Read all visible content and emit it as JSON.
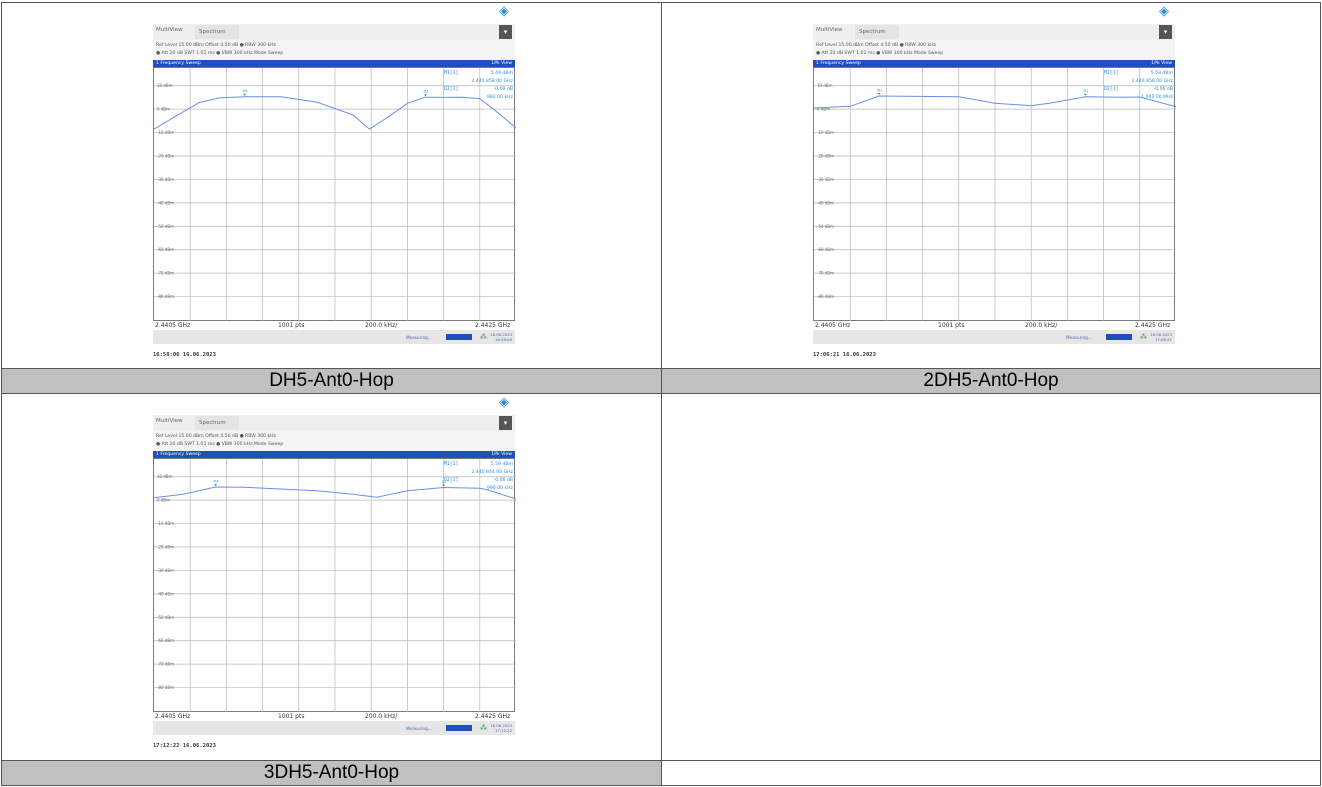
{
  "panels": [
    {
      "caption": "DH5-Ant0-Hop",
      "tabs": [
        "MultiView",
        "Spectrum"
      ],
      "params_line1": "Ref Level 15.00 dBm  Offset 4.50 dB ● RBW 300 kHz",
      "params_line2": "● Att        20 dB  SWT   1.01 ms ● VBW 300 kHz  Mode Sweep",
      "sweep_label": "1 Frequency Sweep",
      "view_label": "1Pk View",
      "marker1_label": "M1[1]",
      "marker1_value": "5.49 dBm",
      "marker1_freq": "2.440 858 00 GHz",
      "delta_label": "D2[1]",
      "delta_value": "-0.09 dB",
      "delta_freq": "982.00 kHz",
      "y_ticks": [
        "10 dBm",
        "0 dBm",
        "-10 dBm",
        "-20 dBm",
        "-30 dBm",
        "-40 dBm",
        "-50 dBm",
        "-60 dBm",
        "-70 dBm",
        "-80 dBm"
      ],
      "x_start": "2.4405 GHz",
      "x_points": "1001 pts",
      "x_span": "200.0 kHz/",
      "x_stop": "2.4425 GHz",
      "status": "Measuring...",
      "status_date": "16.06.2023",
      "status_time": "16:58:06",
      "timestamp": "16:58:06  16.06.2023"
    },
    {
      "caption": "2DH5-Ant0-Hop",
      "tabs": [
        "MultiView",
        "Spectrum"
      ],
      "params_line1": "Ref Level 15.00 dBm  Offset 4.50 dB ● RBW 300 kHz",
      "params_line2": "● Att        20 dB  SWT   1.01 ms ● VBW 300 kHz  Mode Sweep",
      "sweep_label": "1 Frequency Sweep",
      "view_label": "1Pk View",
      "marker1_label": "M1[1]",
      "marker1_value": "5.58 dBm",
      "marker1_freq": "2.440 858 00 GHz",
      "delta_label": "D2[1]",
      "delta_value": "-0.06 dB",
      "delta_freq": "1.000 00 MHz",
      "y_ticks": [
        "10 dBm",
        "0 dBm",
        "-10 dBm",
        "-20 dBm",
        "-30 dBm",
        "-40 dBm",
        "-50 dBm",
        "-60 dBm",
        "-70 dBm",
        "-80 dBm"
      ],
      "x_start": "2.4405 GHz",
      "x_points": "1001 pts",
      "x_span": "200.0 kHz/",
      "x_stop": "2.4425 GHz",
      "status": "Measuring...",
      "status_date": "16.06.2023",
      "status_time": "17:06:21",
      "timestamp": "17:06:21  16.06.2023"
    },
    {
      "caption": "3DH5-Ant0-Hop",
      "tabs": [
        "MultiView",
        "Spectrum"
      ],
      "params_line1": "Ref Level 15.00 dBm  Offset 4.50 dB ● RBW 300 kHz",
      "params_line2": "● Att        20 dB  SWT   1.01 ms ● VBW 300 kHz  Mode Sweep",
      "sweep_label": "1 Frequency Sweep",
      "view_label": "1Pk View",
      "marker1_label": "M1[1]",
      "marker1_value": "5.59 dBm",
      "marker1_freq": "2.440 844 00 GHz",
      "delta_label": "D2[1]",
      "delta_value": "-0.06 dB",
      "delta_freq": "990.00 kHz",
      "y_ticks": [
        "10 dBm",
        "0 dBm",
        "-10 dBm",
        "-20 dBm",
        "-30 dBm",
        "-40 dBm",
        "-50 dBm",
        "-60 dBm",
        "-70 dBm",
        "-80 dBm"
      ],
      "x_start": "2.4405 GHz",
      "x_points": "1001 pts",
      "x_span": "200.0 kHz/",
      "x_stop": "2.4425 GHz",
      "status": "Measuring...",
      "status_date": "16.06.2023",
      "status_time": "17:12:22",
      "timestamp": "17:12:22  16.06.2023"
    }
  ],
  "chart_data": [
    {
      "type": "line",
      "xlabel": "",
      "ylabel": "",
      "xlim": [
        2.4405,
        2.4425
      ],
      "ylim": [
        -90,
        15
      ],
      "series": [
        {
          "x": [
            2.4405,
            2.44062,
            2.44075,
            2.44086,
            2.441,
            2.4412,
            2.4414,
            2.4416,
            2.44169,
            2.4418,
            2.4419,
            2.442,
            2.4421,
            2.4422,
            2.4423,
            2.4424,
            2.4425
          ],
          "values": [
            -8.5,
            -3,
            2.8,
            4.8,
            5.3,
            5.3,
            3,
            -2.5,
            -8.5,
            -3,
            2.5,
            5.1,
            5.0,
            5.1,
            4.5,
            -1.5,
            -8
          ]
        }
      ]
    },
    {
      "type": "line",
      "xlabel": "",
      "ylabel": "",
      "xlim": [
        2.4405,
        2.4425
      ],
      "ylim": [
        -90,
        15
      ],
      "series": [
        {
          "x": [
            2.4405,
            2.4407,
            2.44086,
            2.441,
            2.4413,
            2.4415,
            2.4417,
            2.4418,
            2.442,
            2.4422,
            2.4423,
            2.44238,
            2.4425
          ],
          "values": [
            0.5,
            1.2,
            5.6,
            5.5,
            5.3,
            2.5,
            1.5,
            2.5,
            5.3,
            5.1,
            5.2,
            3.5,
            1.0
          ]
        }
      ]
    },
    {
      "type": "line",
      "xlabel": "",
      "ylabel": "",
      "xlim": [
        2.4405,
        2.4425
      ],
      "ylim": [
        -90,
        15
      ],
      "series": [
        {
          "x": [
            2.4405,
            2.44066,
            2.44084,
            2.441,
            2.4414,
            2.4416,
            2.44173,
            2.4419,
            2.4421,
            2.4423,
            2.44234,
            2.4425
          ],
          "values": [
            1.0,
            2.5,
            5.6,
            5.5,
            4.0,
            2.5,
            1.2,
            4.0,
            5.4,
            5.1,
            4.5,
            0.5
          ]
        }
      ]
    }
  ],
  "colors": {
    "caption_bg": "#c0c0c0",
    "sweep_bar": "#1f4fbf",
    "trace": "#6c8fe6",
    "marker_text": "#2a8de0"
  }
}
